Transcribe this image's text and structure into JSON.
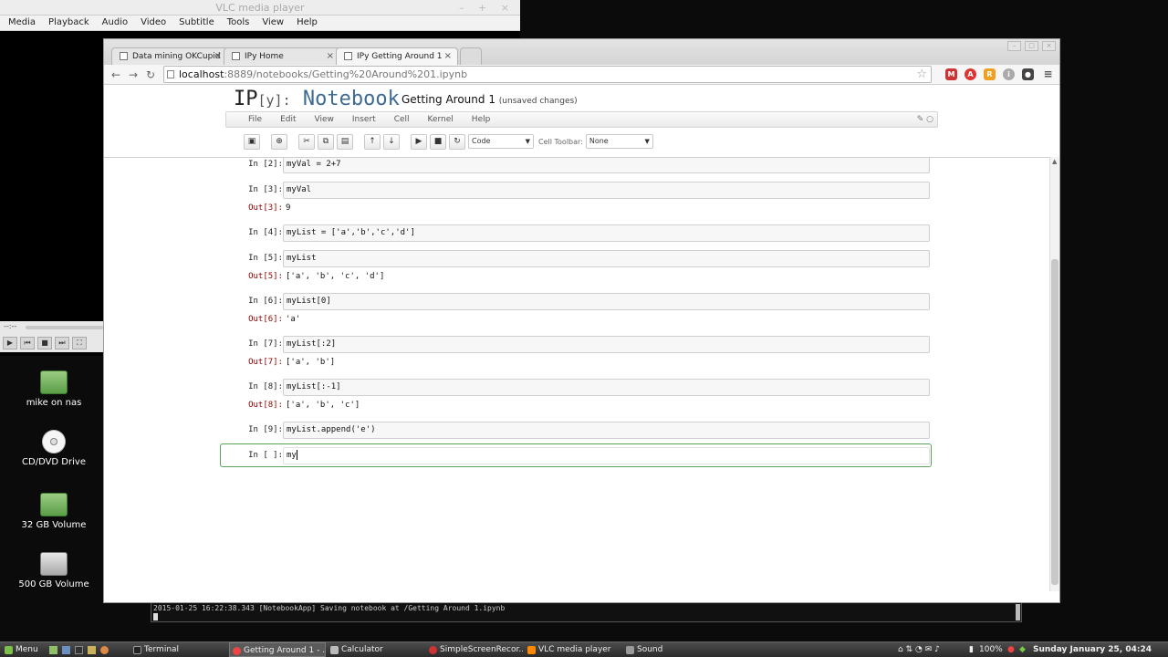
{
  "vlc": {
    "title": "VLC media player",
    "menu": [
      "Media",
      "Playback",
      "Audio",
      "Video",
      "Subtitle",
      "Tools",
      "View",
      "Help"
    ],
    "time": "--:--"
  },
  "desktop": {
    "icons": [
      "mike on nas",
      "CD/DVD Drive",
      "32 GB Volume",
      "500 GB Volume"
    ]
  },
  "terminal": {
    "line": "2015-01-25 16:22:38.343 [NotebookApp] Saving notebook at /Getting Around 1.ipynb"
  },
  "browser": {
    "tabs": [
      "Data mining OKCupid",
      "IPy Home",
      "IPy Getting Around 1"
    ],
    "url_host": "localhost",
    "url_path": ":8889/notebooks/Getting%20Around%201.ipynb"
  },
  "notebook": {
    "logo_ip": "IP",
    "logo_y": "[y]:",
    "logo_word": "Notebook",
    "title": "Getting Around 1",
    "status": "(unsaved changes)",
    "menu": [
      "File",
      "Edit",
      "View",
      "Insert",
      "Cell",
      "Kernel",
      "Help"
    ],
    "celltype": "Code",
    "cell_toolbar_label": "Cell Toolbar:",
    "cell_toolbar_value": "None",
    "cells": [
      {
        "in": "In [2]:",
        "code": "myVal = 2+7"
      },
      {
        "in": "In [3]:",
        "code": "myVal",
        "out_prompt": "Out[3]:",
        "out": "9"
      },
      {
        "in": "In [4]:",
        "code": "myList = ['a','b','c','d']"
      },
      {
        "in": "In [5]:",
        "code": "myList",
        "out_prompt": "Out[5]:",
        "out": "['a', 'b', 'c', 'd']"
      },
      {
        "in": "In [6]:",
        "code": "myList[0]",
        "out_prompt": "Out[6]:",
        "out": "'a'"
      },
      {
        "in": "In [7]:",
        "code": "myList[:2]",
        "out_prompt": "Out[7]:",
        "out": "['a', 'b']"
      },
      {
        "in": "In [8]:",
        "code": "myList[:-1]",
        "out_prompt": "Out[8]:",
        "out": "['a', 'b', 'c']"
      },
      {
        "in": "In [9]:",
        "code": "myList.append('e')"
      },
      {
        "in": "In [ ]:",
        "code": "my"
      }
    ]
  },
  "taskbar": {
    "menu": "Menu",
    "items": [
      "Terminal",
      "Getting Around 1 - ...",
      "Calculator",
      "SimpleScreenRecor...",
      "VLC media player",
      "Sound"
    ],
    "battery": "100%",
    "clock": "Sunday January 25, 04:24 PM"
  },
  "colors": {
    "notebook_blue": "#3d6b95",
    "selected_border": "#5aa15a",
    "out_prompt": "#8b0000"
  }
}
